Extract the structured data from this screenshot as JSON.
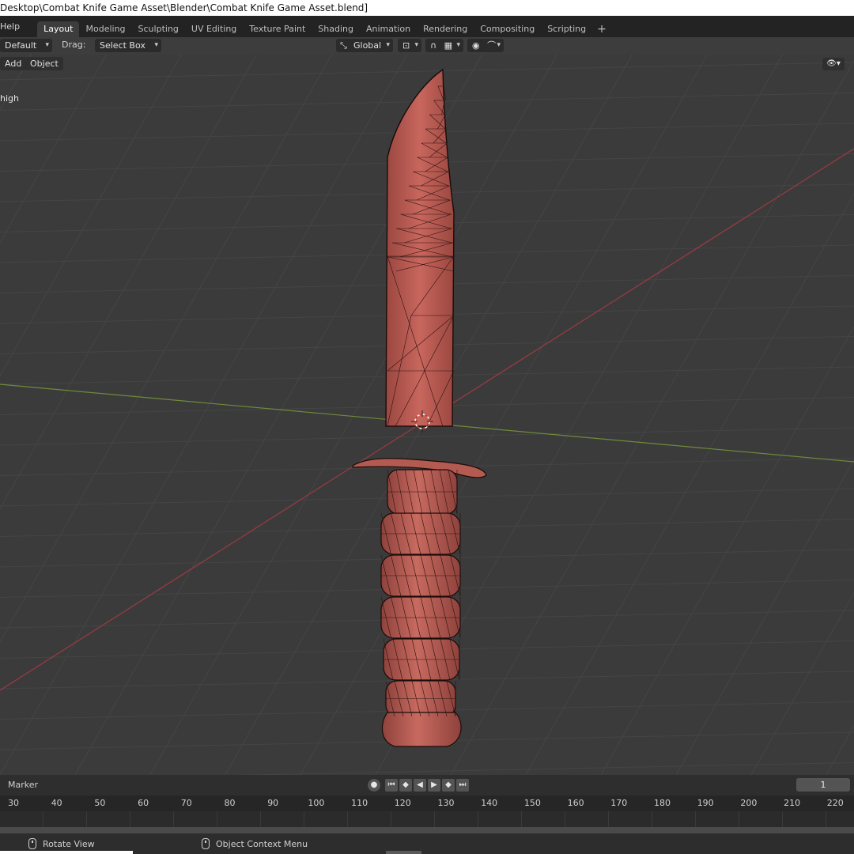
{
  "window": {
    "title": "Desktop\\Combat Knife Game Asset\\Blender\\Combat Knife Game Asset.blend]"
  },
  "menu": {
    "help": "Help"
  },
  "workspaces": [
    "Layout",
    "Modeling",
    "Sculpting",
    "UV Editing",
    "Texture Paint",
    "Shading",
    "Animation",
    "Rendering",
    "Compositing",
    "Scripting"
  ],
  "active_workspace": "Layout",
  "add_workspace": "+",
  "toolbar": {
    "mode": "Default",
    "drag_label": "Drag:",
    "drag_value": "Select Box",
    "orientation": "Global"
  },
  "viewport_header": {
    "add": "Add",
    "object": "Object"
  },
  "viewport": {
    "object_label": "high"
  },
  "timeline": {
    "marker": "Marker",
    "current_frame": "1",
    "ticks": [
      30,
      40,
      50,
      60,
      70,
      80,
      90,
      100,
      110,
      120,
      130,
      140,
      150,
      160,
      170,
      180,
      190,
      200,
      210,
      220
    ],
    "playback_icons": [
      "record-icon",
      "jump-start-icon",
      "prev-keyframe-icon",
      "play-reverse-icon",
      "play-icon",
      "next-keyframe-icon",
      "jump-end-icon"
    ]
  },
  "status": {
    "left": "Rotate View",
    "middle": "Object Context Menu"
  },
  "colors": {
    "viewport_bg": "#3b3b3b",
    "grid": "#454545",
    "x_axis": "#9c3b44",
    "y_axis": "#6e8b3a",
    "knife_fill": "#b85a52",
    "wire": "#2a1412",
    "active_tab": "#3d3d3d"
  }
}
